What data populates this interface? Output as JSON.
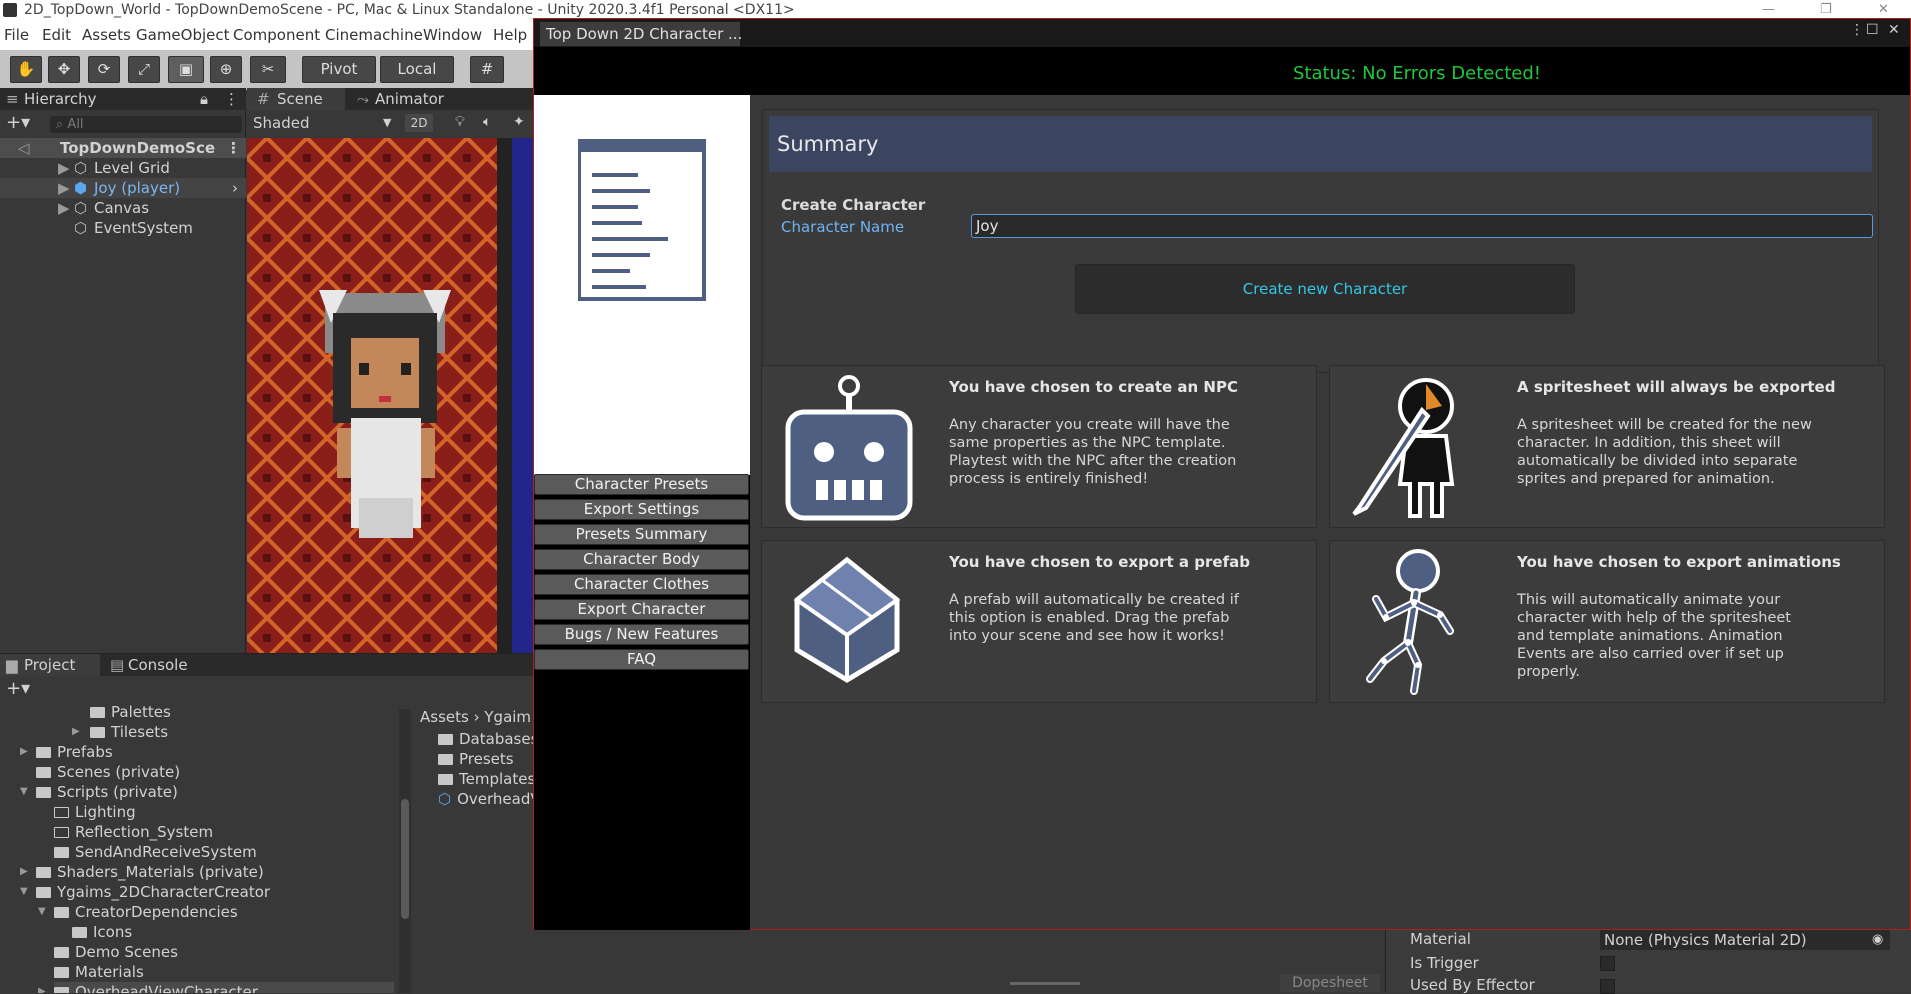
{
  "window": {
    "title": "2D_TopDown_World - TopDownDemoScene - PC, Mac & Linux Standalone - Unity 2020.3.4f1 Personal <DX11>"
  },
  "menu": [
    "File",
    "Edit",
    "Assets",
    "GameObject",
    "Component",
    "Cinemachine",
    "Window",
    "Help"
  ],
  "toolbar": {
    "pivot": "Pivot",
    "local": "Local"
  },
  "hierarchy": {
    "tab": "Hierarchy",
    "search_placeholder": "All",
    "scene": "TopDownDemoSce",
    "items": [
      "Level Grid",
      "Joy (player)",
      "Canvas",
      "EventSystem"
    ]
  },
  "scene_view": {
    "tab_scene": "Scene",
    "tab_animator": "Animator",
    "shading": "Shaded",
    "mode": "2D"
  },
  "project": {
    "tab_project": "Project",
    "tab_console": "Console",
    "tree": [
      {
        "label": "Palettes",
        "indent": 4
      },
      {
        "label": "Tilesets",
        "indent": 4
      },
      {
        "label": "Prefabs",
        "indent": 2
      },
      {
        "label": "Scenes (private)",
        "indent": 2
      },
      {
        "label": "Scripts (private)",
        "indent": 2
      },
      {
        "label": "Lighting",
        "indent": 3
      },
      {
        "label": "Reflection_System",
        "indent": 3
      },
      {
        "label": "SendAndReceiveSystem",
        "indent": 3
      },
      {
        "label": "Shaders_Materials (private)",
        "indent": 2
      },
      {
        "label": "Ygaims_2DCharacterCreator",
        "indent": 2
      },
      {
        "label": "CreatorDependencies",
        "indent": 3
      },
      {
        "label": "Icons",
        "indent": 4
      },
      {
        "label": "Demo Scenes",
        "indent": 3
      },
      {
        "label": "Materials",
        "indent": 3
      },
      {
        "label": "OverheadViewCharacter",
        "indent": 3
      }
    ],
    "breadcrumb_root": "Assets",
    "breadcrumb_child": "Ygaim",
    "files": [
      "Databases",
      "Presets",
      "Templates",
      "OverheadV"
    ]
  },
  "bottom": {
    "dopesheet": "Dopesheet",
    "material_label": "Material",
    "material_value": "None (Physics Material 2D)",
    "is_trigger": "Is Trigger",
    "used_by_effector": "Used By Effector"
  },
  "editor": {
    "tab": "Top Down 2D Character ...",
    "status": "Status: No Errors Detected!",
    "nav": [
      "Character Presets",
      "Export Settings",
      "Presets Summary",
      "Character Body",
      "Character Clothes",
      "Export Character",
      "Bugs / New Features",
      "FAQ"
    ],
    "summary_title": "Summary",
    "create_label": "Create Character",
    "name_label": "Character Name",
    "name_value": "Joy",
    "create_button": "Create new Character",
    "cards": [
      {
        "title": "You have chosen to create an NPC",
        "body": "Any character you create will have the same properties as the NPC template. Playtest with the NPC after the creation process is entirely finished!",
        "icon": "robot-icon"
      },
      {
        "title": "A spritesheet will always be exported",
        "body": "A spritesheet will be created for the new character. In addition, this sheet will automatically be divided into separate sprites and prepared for animation.",
        "icon": "brush-figure-icon"
      },
      {
        "title": "You have chosen to export a prefab",
        "body": "A prefab will automatically be created if this option is enabled. Drag the prefab into your scene and see how it works!",
        "icon": "cube-icon"
      },
      {
        "title": "You have chosen to export animations",
        "body": "This will automatically animate your character with help of the spritesheet and template animations. Animation Events are also carried over if set up properly.",
        "icon": "running-figure-icon"
      }
    ]
  },
  "colors": {
    "status_green": "#1ec83a",
    "link_blue": "#6fb3f0",
    "button_cyan": "#35c6e6",
    "header_blue": "#3b4560",
    "icon_blue": "#4e5f82"
  }
}
